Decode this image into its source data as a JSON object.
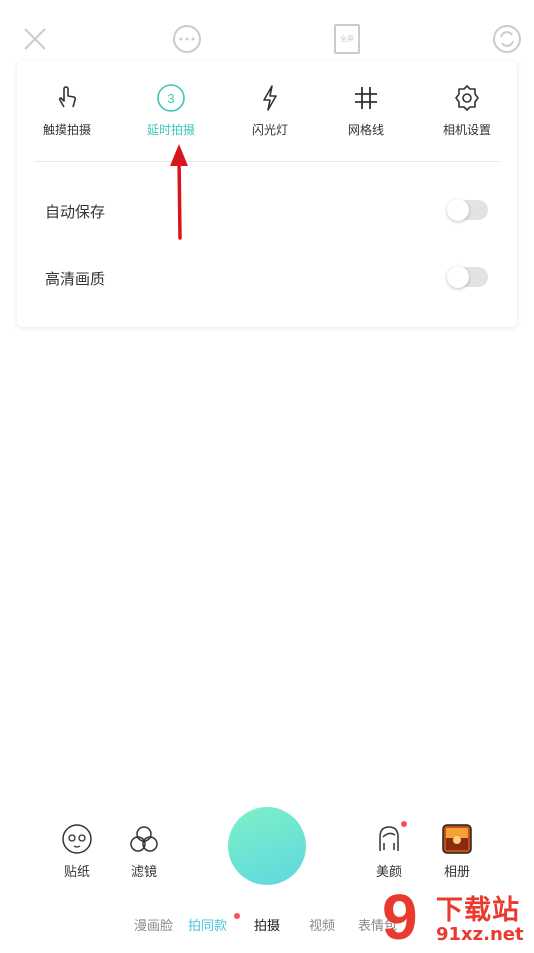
{
  "top_bar": {
    "icons": [
      "close-icon",
      "more-icon",
      "ratio-icon",
      "switch-camera-icon"
    ],
    "ratio_label": "全屏"
  },
  "settings": {
    "tools": [
      {
        "label": "触摸拍摄",
        "icon": "touch-icon"
      },
      {
        "label": "延时拍摄",
        "icon": "timer-icon",
        "value": "3",
        "active": true
      },
      {
        "label": "闪光灯",
        "icon": "flash-icon"
      },
      {
        "label": "网格线",
        "icon": "grid-icon"
      },
      {
        "label": "相机设置",
        "icon": "gear-icon"
      }
    ],
    "toggles": [
      {
        "label": "自动保存",
        "on": false
      },
      {
        "label": "高清画质",
        "on": false
      }
    ]
  },
  "bottom": {
    "left": [
      {
        "label": "贴纸",
        "icon": "sticker-icon"
      },
      {
        "label": "滤镜",
        "icon": "filter-icon"
      }
    ],
    "right": [
      {
        "label": "美颜",
        "icon": "beauty-icon"
      },
      {
        "label": "相册",
        "icon": "album-icon"
      }
    ],
    "modes": [
      "漫画脸",
      "拍同款",
      "拍摄",
      "视频",
      "表情包"
    ],
    "selected_mode": "拍摄"
  },
  "watermark": {
    "line1": "下载站",
    "line2": "91xz.net",
    "logo": "9"
  },
  "colors": {
    "accent": "#3bc7bb",
    "arrow": "#d9161c",
    "badge": "#ff4d5e"
  }
}
